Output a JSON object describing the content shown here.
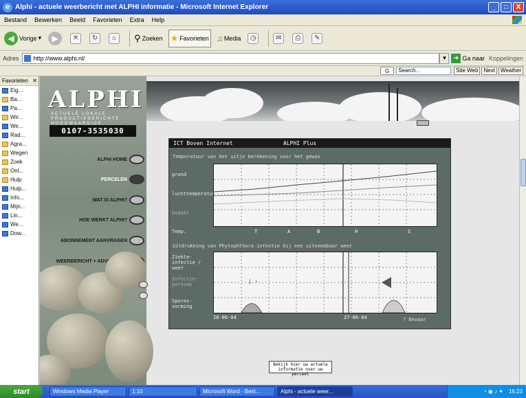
{
  "window": {
    "title": "Alphi - actuele weerbericht met ALPHI informatie - Microsoft Internet Explorer",
    "min": "_",
    "max": "□",
    "close": "X"
  },
  "menu": [
    "Bestand",
    "Bewerken",
    "Beeld",
    "Favorieten",
    "Extra",
    "Help"
  ],
  "toolbar": {
    "back": "Vorige",
    "search": "Zoeken",
    "favorites": "Favorieten",
    "media": "Media"
  },
  "address": {
    "label": "Adres",
    "url": "http://www.alphi.nl/",
    "go": "Ga naar",
    "links": "Koppelingen"
  },
  "google_bar": {
    "search_label": "Search...",
    "buttons": [
      "Site Web",
      "Next",
      "Weather"
    ]
  },
  "favorites": {
    "header": "Favorieten",
    "items": [
      {
        "label": "Eig...",
        "type": "page"
      },
      {
        "label": "Ba...",
        "type": "folder"
      },
      {
        "label": "Pa...",
        "type": "page"
      },
      {
        "label": "Wir...",
        "type": "folder"
      },
      {
        "label": "We...",
        "type": "page"
      },
      {
        "label": "Rad...",
        "type": "page"
      },
      {
        "label": "Agra...",
        "type": "folder"
      },
      {
        "label": "Wegen",
        "type": "folder"
      },
      {
        "label": "Zoek",
        "type": "folder"
      },
      {
        "label": "Onl...",
        "type": "folder"
      },
      {
        "label": "Hulp",
        "type": "folder"
      },
      {
        "label": "Hulp...",
        "type": "page"
      },
      {
        "label": "Info...",
        "type": "page"
      },
      {
        "label": "Mijn...",
        "type": "page"
      },
      {
        "label": "Lin...",
        "type": "page"
      },
      {
        "label": "We...",
        "type": "page"
      },
      {
        "label": "Dow...",
        "type": "page"
      }
    ]
  },
  "alphi": {
    "logo": "ALPHI",
    "logo_sub": "ACTUELE LOKALE PRODUCTIEGERICHTE HOOGWAARDIGE INFORMATIE",
    "phone": "0107-3535030",
    "nav": [
      {
        "label": "ALPHI HOME",
        "active": false
      },
      {
        "label": "PERCELEN",
        "active": true
      },
      {
        "label": "WAT IS ALPHI?",
        "active": false
      },
      {
        "label": "HOE WERKT ALPHI?",
        "active": false
      },
      {
        "label": "ABONNEMENT AANVRAGEN",
        "active": false
      },
      {
        "label": "WEERBERICHT + ADVISERING",
        "active": false
      }
    ]
  },
  "panel": {
    "title_left": "ICT Boven Internet",
    "title_right": "ALPHI Plus",
    "section1": "Temperatuur van het uitje berekening voor het gewas",
    "section2": "Uitdrukking van Phytophthora infectie bij een uitneembaar weer",
    "chart1_labels": [
      "grond",
      "luchttemperatuur",
      "bedekt"
    ],
    "chart1_bottom": "Temp.",
    "chart2_labels": [
      "Ziekte-infectie / weer",
      "Infectie-periode",
      "Spores-vorming"
    ],
    "ticks1": [
      "T",
      "A",
      "B",
      "H",
      "S"
    ],
    "date_left": "28-06-04",
    "date_right": "27-06-04",
    "legend_hint": "? Bewaar"
  },
  "info_button": "Bekijk hier uw actuele informatie over uw perceel",
  "taskbar": {
    "start": "start",
    "items": [
      "Windows Media Player",
      "1:10",
      "Microsoft Word - Best...",
      "Alphi - actuele weer..."
    ],
    "clock": "16:23"
  }
}
